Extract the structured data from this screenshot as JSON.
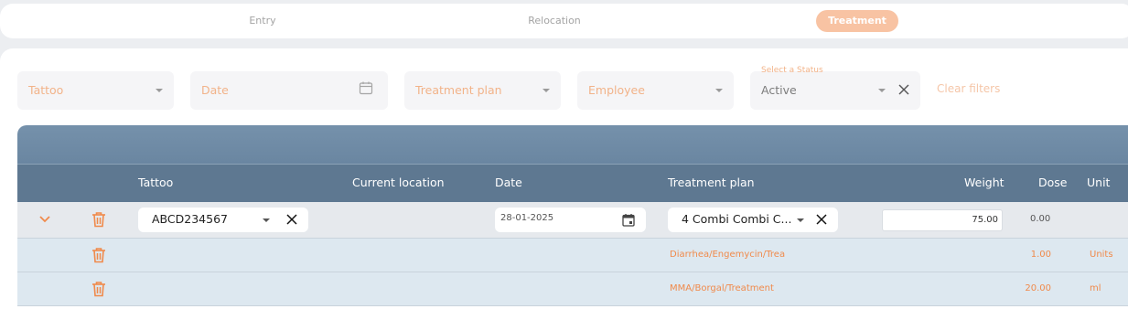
{
  "tabs": [
    {
      "label": "Entry",
      "active": false
    },
    {
      "label": "Relocation",
      "active": false
    },
    {
      "label": "Treatment",
      "active": true
    }
  ],
  "filters": {
    "tattoo": {
      "placeholder": "Tattoo"
    },
    "date": {
      "placeholder": "Date"
    },
    "treatment_plan": {
      "placeholder": "Treatment plan"
    },
    "employee": {
      "placeholder": "Employee"
    },
    "status": {
      "label": "Select a Status",
      "value": "Active"
    },
    "clear_label": "Clear filters"
  },
  "table": {
    "columns": {
      "tattoo": "Tattoo",
      "current_location": "Current location",
      "date": "Date",
      "treatment_plan": "Treatment plan",
      "weight": "Weight",
      "dose": "Dose",
      "unit": "Unit"
    },
    "main_row": {
      "tattoo": "ABCD234567",
      "date": "28-01-2025",
      "treatment_plan": "4 Combi Combi C...",
      "weight": "75.00",
      "dose": "0.00"
    },
    "sub_rows": [
      {
        "treatment_plan": "Diarrhea/Engemycin/Trea",
        "dose": "1.00",
        "unit": "Units"
      },
      {
        "treatment_plan": "MMA/Borgal/Treatment",
        "dose": "20.00",
        "unit": "ml"
      }
    ]
  },
  "colors": {
    "accent": "#f08a4b",
    "accent_light": "#f8c3a3",
    "header": "#5e7891"
  },
  "icons": [
    "calendar-icon",
    "close-icon",
    "chevron-down-icon",
    "trash-icon",
    "dropdown-caret-icon"
  ]
}
